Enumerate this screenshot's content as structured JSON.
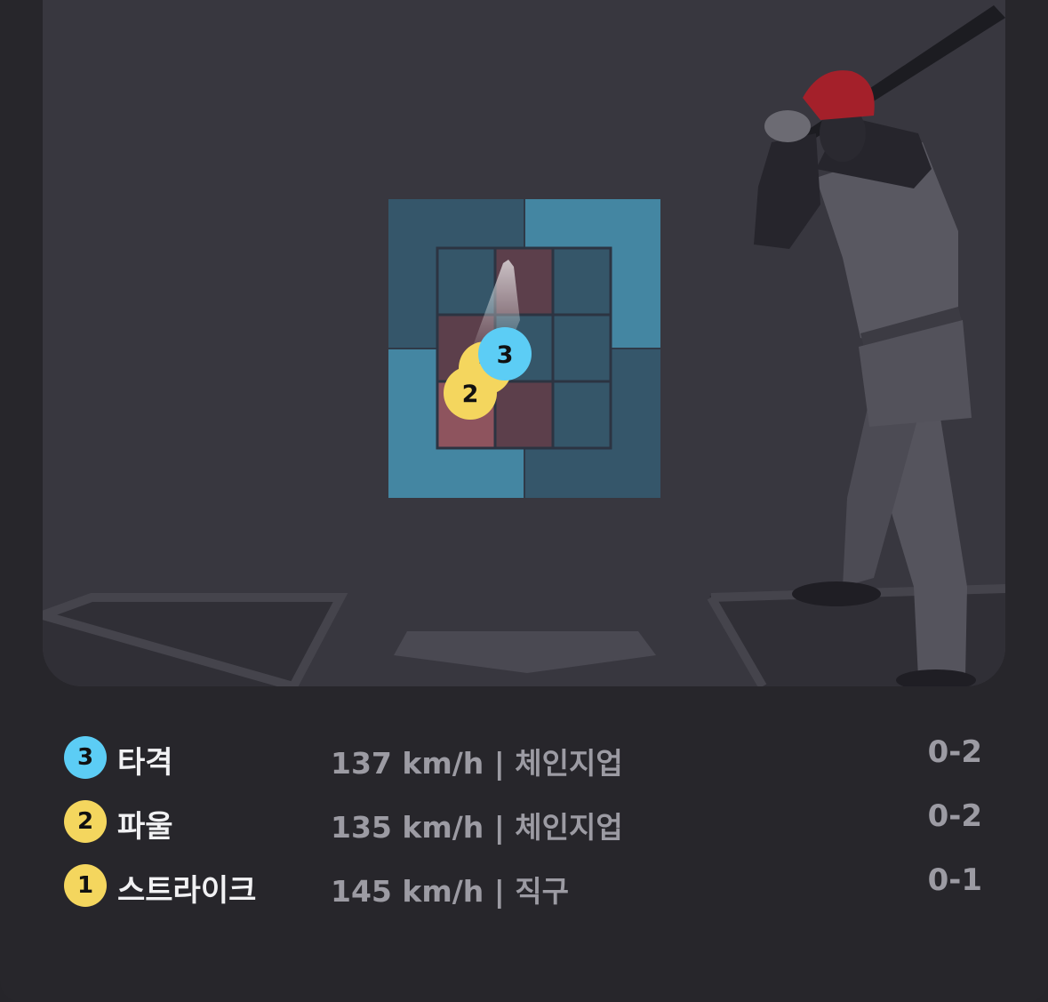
{
  "colors": {
    "hit": "#5ccdf5",
    "foul": "#f4d65e",
    "strike": "#f4d65e",
    "zone_outer_dark": "#35566a",
    "zone_outer_light": "#4486a2",
    "zone_hot": "#8e545e",
    "zone_warm": "#5c3f4b",
    "zone_cool": "#355669",
    "helmet": "#a4202a"
  },
  "strike_zone": {
    "inner_grid": [
      [
        "cool",
        "warm",
        "cool"
      ],
      [
        "warm",
        "cool",
        "cool"
      ],
      [
        "hot",
        "warm",
        "cool"
      ]
    ]
  },
  "markers": [
    {
      "number": "1",
      "color": "#f4d65e"
    },
    {
      "number": "2",
      "color": "#f4d65e"
    },
    {
      "number": "3",
      "color": "#5ccdf5"
    }
  ],
  "pitches": [
    {
      "number": "3",
      "result": "타격",
      "info": "137 km/h | 체인지업",
      "count": "0-2",
      "color": "#5ccdf5"
    },
    {
      "number": "2",
      "result": "파울",
      "info": "135 km/h | 체인지업",
      "count": "0-2",
      "color": "#f4d65e"
    },
    {
      "number": "1",
      "result": "스트라이크",
      "info": "145 km/h | 직구",
      "count": "0-1",
      "color": "#f4d65e"
    }
  ]
}
